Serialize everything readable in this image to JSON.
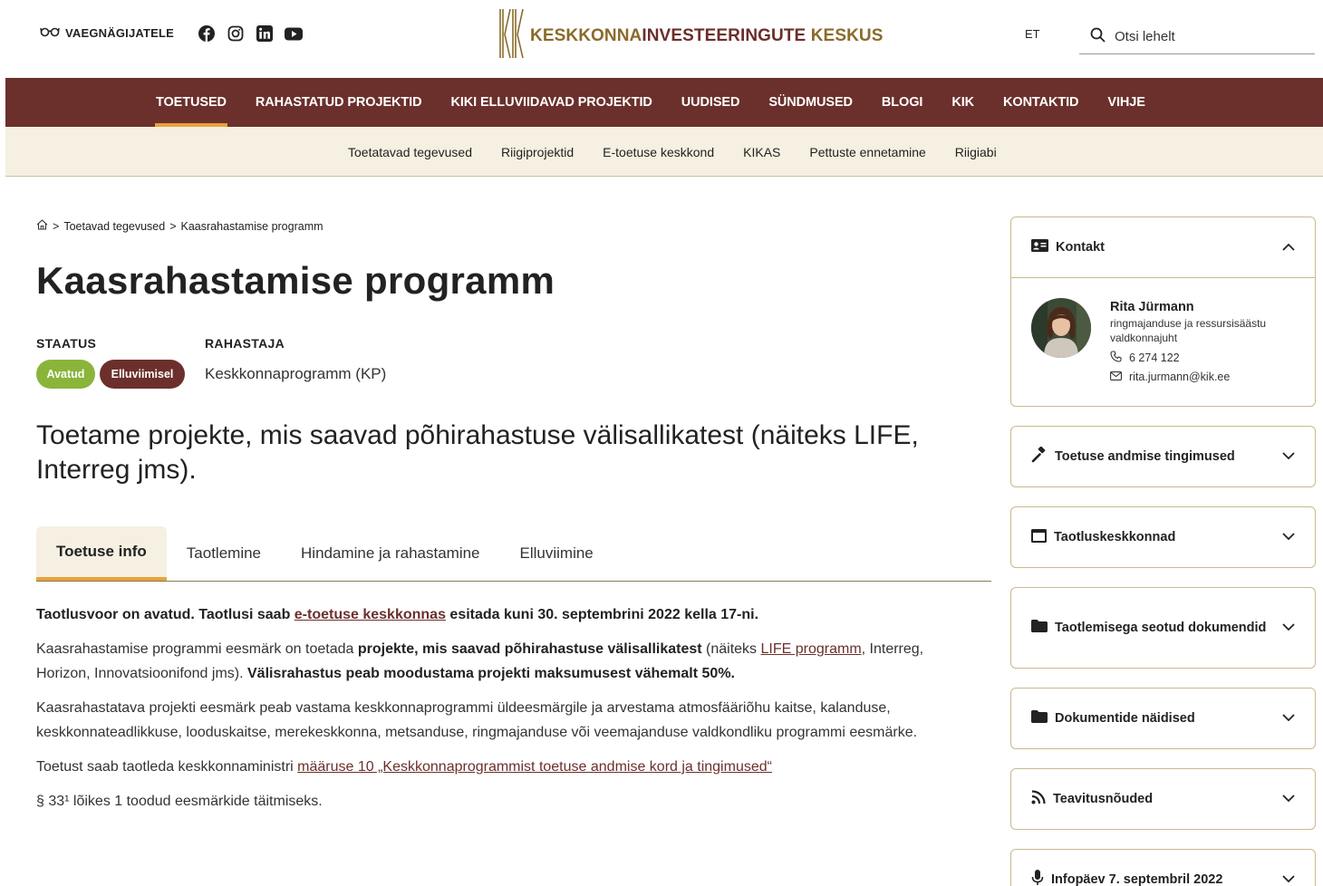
{
  "header": {
    "accessibility_label": "VAEGNÄGIJATELE",
    "logo": {
      "part1": "KESKKONNA",
      "part2": "INVESTEERINGUTE",
      "part3": " KESKUS"
    },
    "language": "ET",
    "search_placeholder": "Otsi lehelt"
  },
  "main_nav": [
    "TOETUSED",
    "RAHASTATUD PROJEKTID",
    "KIKI ELLUVIIDAVAD PROJEKTID",
    "UUDISED",
    "SÜNDMUSED",
    "BLOGI",
    "KIK",
    "KONTAKTID",
    "VIHJE"
  ],
  "sub_nav": [
    "Toetatavad tegevused",
    "Riigiprojektid",
    "E-toetuse keskkond",
    "KIKAS",
    "Pettuste ennetamine",
    "Riigiabi"
  ],
  "breadcrumb": {
    "sep": ">",
    "item1": "Toetavad tegevused",
    "item2": "Kaasrahastamise programm"
  },
  "page": {
    "title": "Kaasrahastamise programm",
    "status_label": "STAATUS",
    "funder_label": "RAHASTAJA",
    "badge_open": "Avatud",
    "badge_impl": "Elluviimisel",
    "funder": "Keskkonnaprogramm (KP)",
    "lead": "Toetame projekte, mis saavad põhirahastuse välisallikatest (näiteks LIFE, Interreg jms)."
  },
  "tabs": [
    "Toetuse info",
    "Taotlemine",
    "Hindamine ja rahastamine",
    "Elluviimine"
  ],
  "content": {
    "p1_a": "Taotlusvoor on avatud. Taotlusi saab ",
    "p1_link": "e-toetuse keskkonnas",
    "p1_b": " esitada kuni 30. septembrini 2022 kella 17-ni.",
    "p2_a": "Kaasrahastamise programmi eesmärk on toetada ",
    "p2_bold": "projekte, mis saavad põhirahastuse välisallikatest",
    "p2_b": " (näiteks ",
    "p2_link": "LIFE programm",
    "p2_c": ", Interreg, Horizon, Innovatsioonifond jms). ",
    "p2_bold2": "Välisrahastus peab moodustama projekti maksumusest vähemalt 50%.",
    "p3": "Kaasrahastatava projekti eesmärk peab vastama keskkonnaprogrammi üldeesmärgile ja arvestama atmosfääriõhu kaitse, kalanduse, keskkonnateadlikkuse, looduskaitse, merekeskkonna, metsanduse, ringmajanduse või veemajanduse valdkondliku programmi eesmärke.",
    "p4_a": "Toetust saab taotleda keskkonnaministri ",
    "p4_link": "määruse 10 „Keskkonnaprogrammist toetuse andmise kord ja tingimused“",
    "p5": "§ 33¹ lõikes 1 toodud eesmärkide täitmiseks."
  },
  "sidebar": {
    "contact": {
      "title": "Kontakt",
      "name": "Rita Jürmann",
      "role": "ringmajanduse ja ressursisäästu valdkonnajuht",
      "phone": "6 274 122",
      "email": "rita.jurmann@kik.ee"
    },
    "cards": [
      {
        "title": "Toetuse andmise tingimused",
        "icon": "gavel-icon"
      },
      {
        "title": "Taotluskeskkonnad",
        "icon": "window-icon"
      },
      {
        "title": "Taotlemisega seotud dokumendid",
        "icon": "folder-icon"
      },
      {
        "title": "Dokumentide näidised",
        "icon": "folder-icon"
      },
      {
        "title": "Teavitusnõuded",
        "icon": "rss-icon"
      },
      {
        "title": "Infopäev 7. septembril 2022",
        "icon": "microphone-icon"
      }
    ]
  }
}
